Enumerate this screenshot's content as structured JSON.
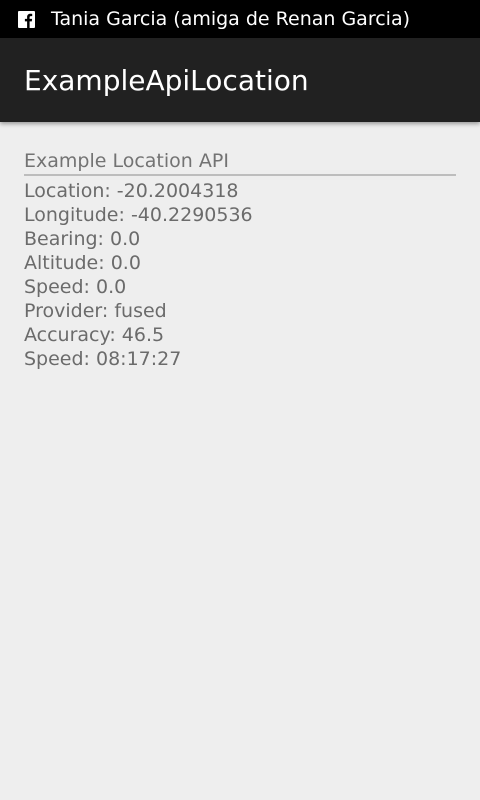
{
  "status_bar": {
    "notification_icon": "facebook-icon",
    "notification_text": "Tania Garcia (amiga de Renan Garcia)"
  },
  "app_bar": {
    "title": "ExampleApiLocation"
  },
  "section": {
    "header": "Example Location API",
    "fields": [
      {
        "text": "Location: -20.2004318"
      },
      {
        "text": "Longitude: -40.2290536"
      },
      {
        "text": "Bearing: 0.0"
      },
      {
        "text": "Altitude: 0.0"
      },
      {
        "text": "Speed: 0.0"
      },
      {
        "text": "Provider: fused"
      },
      {
        "text": "Accuracy: 46.5"
      },
      {
        "text": "Speed: 08:17:27"
      }
    ]
  },
  "colors": {
    "status_bar_bg": "#000000",
    "app_bar_bg": "#212121",
    "content_bg": "#eeeeee",
    "text_secondary": "#6b6b6b",
    "divider": "#bdbdbd"
  }
}
